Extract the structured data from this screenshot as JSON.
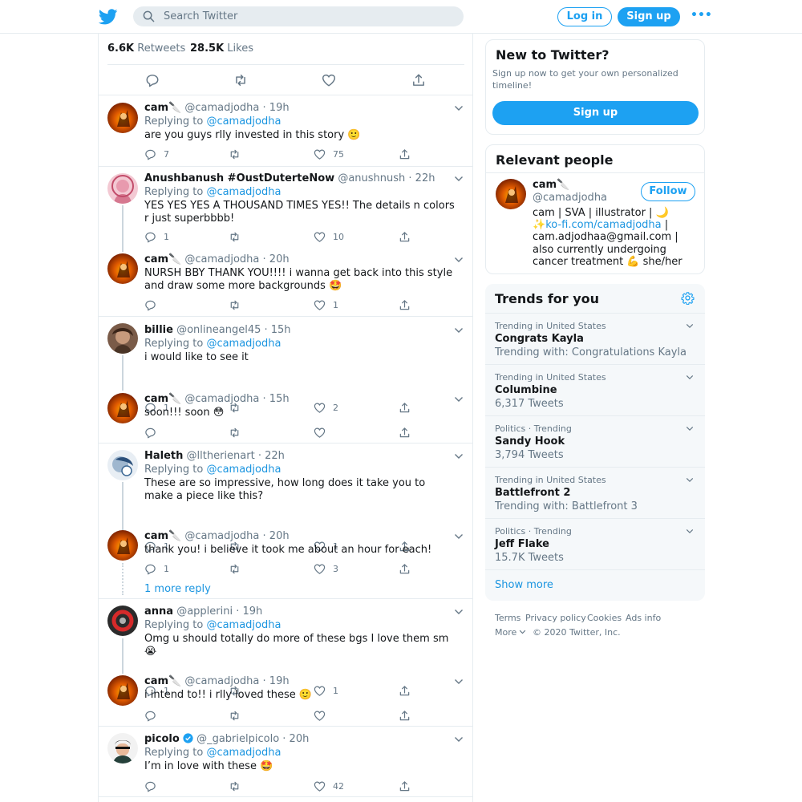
{
  "header": {
    "search_placeholder": "Search Twitter",
    "login_label": "Log in",
    "signup_label": "Sign up",
    "more_label": "•••"
  },
  "stats": {
    "retweets_count": "6.6K",
    "retweets_label": "Retweets",
    "likes_count": "28.5K",
    "likes_label": "Likes"
  },
  "tweets": [
    {
      "name": "cam🔪",
      "handle": "@camadjodha",
      "time": "· 19h",
      "replying_label": "Replying to",
      "replying_to": "@camadjodha",
      "text": "are you guys rlly invested in this story 🙂",
      "replies": "7",
      "retweets": "",
      "likes": "75"
    },
    {
      "name": "Anushbanush #OustDuterteNow",
      "handle": "@anushnush",
      "time": "· 22h",
      "replying_label": "Replying to",
      "replying_to": "@camadjodha",
      "text": "YES YES YES A THOUSAND TIMES YES!! The details n colors r just superbbbb!",
      "replies": "1",
      "retweets": "",
      "likes": "10"
    },
    {
      "name": "cam🔪",
      "handle": "@camadjodha",
      "time": "· 20h",
      "text": "NURSH BBY THANK YOU!!!! i wanna get back into this style and draw some more backgrounds 🤩",
      "replies": "",
      "retweets": "",
      "likes": "1"
    },
    {
      "name": "billie",
      "handle": "@onlineangel45",
      "time": "· 15h",
      "replying_label": "Replying to",
      "replying_to": "@camadjodha",
      "text": "i would like to see it",
      "replies": "1",
      "retweets": "",
      "likes": "2"
    },
    {
      "name": "cam🔪",
      "handle": "@camadjodha",
      "time": "· 15h",
      "text": "soon!!! soon 😳",
      "replies": "",
      "retweets": "",
      "likes": ""
    },
    {
      "name": "Haleth",
      "handle": "@lltherienart",
      "time": "· 22h",
      "replying_label": "Replying to",
      "replying_to": "@camadjodha",
      "text": "These are so impressive, how long does it take you to make a piece like this?",
      "replies": "1",
      "retweets": "",
      "likes": "1"
    },
    {
      "name": "cam🔪",
      "handle": "@camadjodha",
      "time": "· 20h",
      "text": "thank you! i believe it took me about an hour for each!",
      "replies": "1",
      "retweets": "",
      "likes": "3",
      "more_replies": "1 more reply"
    },
    {
      "name": "anna",
      "handle": "@applerini",
      "time": "· 19h",
      "replying_label": "Replying to",
      "replying_to": "@camadjodha",
      "text": "Omg u should totally do more of these bgs I love them sm 😭",
      "replies": "1",
      "retweets": "",
      "likes": "1"
    },
    {
      "name": "cam🔪",
      "handle": "@camadjodha",
      "time": "· 19h",
      "text": "i intend to!! i rlly loved these 🙂",
      "replies": "",
      "retweets": "",
      "likes": ""
    },
    {
      "name": "picolo",
      "handle": "@_gabrielpicolo",
      "time": "· 20h",
      "replying_label": "Replying to",
      "replying_to": "@camadjodha",
      "text": "I’m in love with these 🤩",
      "replies": "",
      "retweets": "",
      "likes": "42"
    }
  ],
  "sidebar": {
    "new_to_twitter": {
      "title": "New to Twitter?",
      "subtitle": "Sign up now to get your own personalized timeline!",
      "button": "Sign up"
    },
    "relevant_people": {
      "title": "Relevant people",
      "name": "cam🔪",
      "handle": "@camadjodha",
      "follow_label": "Follow",
      "bio_prefix": "cam | SVA | illustrator | 🌙✨",
      "bio_link": "ko-fi.com/camadjodha",
      "bio_suffix": " | cam.adjodhaa@gmail.com | also currently undergoing cancer treatment 💪 she/her"
    },
    "trends": {
      "title": "Trends for you",
      "items": [
        {
          "meta": "Trending in United States",
          "name": "Congrats Kayla",
          "sub": "Trending with: Congratulations Kayla"
        },
        {
          "meta": "Trending in United States",
          "name": "Columbine",
          "sub": "6,317 Tweets"
        },
        {
          "meta": "Politics · Trending",
          "name": "Sandy Hook",
          "sub": "3,794 Tweets"
        },
        {
          "meta": "Trending in United States",
          "name": "Battlefront 2",
          "sub": "Trending with: Battlefront 3"
        },
        {
          "meta": "Politics · Trending",
          "name": "Jeff Flake",
          "sub": "15.7K Tweets"
        }
      ],
      "show_more": "Show more"
    }
  },
  "footer": {
    "terms": "Terms",
    "privacy": "Privacy policy",
    "cookies": "Cookies",
    "ads_info": "Ads info",
    "more": "More",
    "copyright": "© 2020 Twitter, Inc."
  },
  "colors": {
    "accent": "#1da1f2",
    "link": "#1b95e0",
    "secondary_text": "#657786",
    "border": "#e6ecf0",
    "verified": "#1da1f2"
  }
}
